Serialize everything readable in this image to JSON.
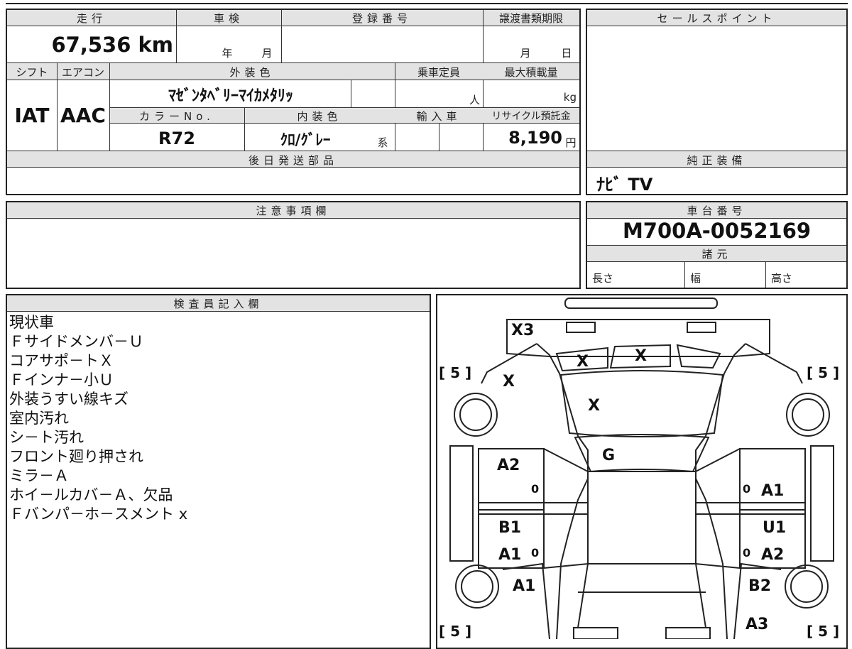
{
  "vehicle": {
    "mileage_label": "走行",
    "mileage_value": "67,536 km",
    "shaken_label": "車検",
    "shaken_year_unit": "年",
    "shaken_month_unit": "月",
    "registration_label": "登録番号",
    "deadline_label": "譲渡書類期限",
    "deadline_month_unit": "月",
    "deadline_day_unit": "日",
    "shift_label": "シフト",
    "shift_value": "IAT",
    "aircon_label": "エアコン",
    "aircon_value": "AAC",
    "exterior_color_label": "外装色",
    "exterior_color_value": "ﾏｾﾞﾝﾀﾍﾞﾘｰﾏｲｶﾒﾀﾘｯ",
    "capacity_label": "乗車定員",
    "capacity_unit": "人",
    "max_load_label": "最大積載量",
    "max_load_unit": "kg",
    "color_no_label": "カラーNo.",
    "color_no_value": "R72",
    "interior_color_label": "内装色",
    "interior_color_value": "ｸﾛ/ｸﾞﾚｰ",
    "interior_suffix": "系",
    "import_label": "輸入車",
    "recycle_label": "リサイクル預託金",
    "recycle_value": "8,190",
    "recycle_unit": "円",
    "later_parts_label": "後日発送部品"
  },
  "sales_point": {
    "label": "セールスポイント"
  },
  "genuine_equipment": {
    "label": "純正装備",
    "value": "ﾅﾋﾞ TV"
  },
  "caution": {
    "label": "注意事項欄"
  },
  "chassis": {
    "label": "車台番号",
    "value": "M700A-0052169",
    "specs_label": "諸元",
    "length_label": "長さ",
    "width_label": "幅",
    "height_label": "高さ"
  },
  "inspector": {
    "label": "検査員記入欄",
    "notes": [
      "現状車",
      "Ｆサイドメンバ－Ｕ",
      "コアサポ－トＸ",
      "Ｆインナ－小Ｕ",
      "外装うすい線キズ",
      "室内汚れ",
      "シ－ト汚れ",
      "フロント廻り押され",
      "ミラ－Ａ",
      "ホイ－ルカバ－Ａ、欠品",
      "Ｆバンパ－ホ－スメント x"
    ]
  },
  "diagram": {
    "marks": {
      "roof_rear": "X3",
      "rear_glass_left": "X",
      "rear_glass_right": "X",
      "rear_panel_left": "X",
      "roof": "X",
      "windshield": "G",
      "door_left_rear": "A2",
      "door_left_front_top": "B1",
      "door_left_front_bottom": "A1",
      "fender_left": "A1",
      "door_right_rear": "A1",
      "door_right_front_top": "U1",
      "door_right_front_bottom": "A2",
      "fender_right": "B2",
      "front_right": "A3",
      "tire_rear_left": "[ 5 ]",
      "tire_rear_right": "[ 5 ]",
      "tire_front_left": "[ 5 ]",
      "tire_front_right": "[ 5 ]",
      "zero": "0"
    }
  }
}
